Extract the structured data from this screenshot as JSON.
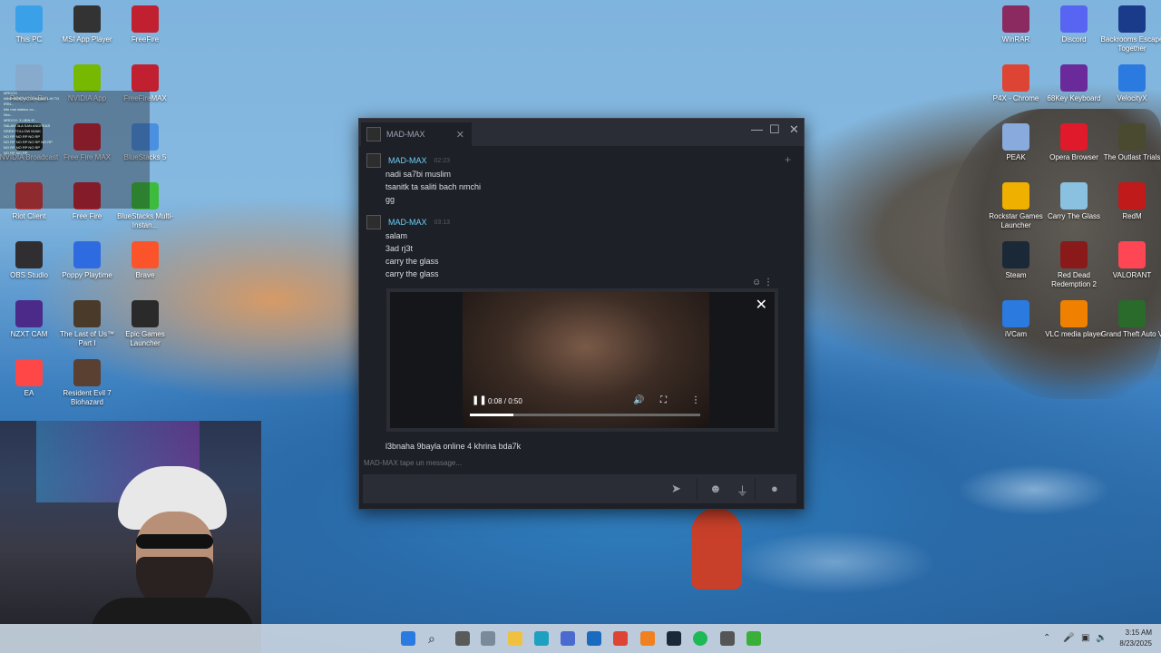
{
  "desktop": {
    "left_icons": [
      {
        "label": "This PC",
        "color": "#3aa0e8"
      },
      {
        "label": "MSI App Player",
        "color": "#333333"
      },
      {
        "label": "FreeFire",
        "color": "#c02030"
      },
      {
        "label": "Recycle Bin",
        "color": "#88aacc"
      },
      {
        "label": "NVIDIA App",
        "color": "#76b900"
      },
      {
        "label": "FreeFireMAX",
        "color": "#c02030"
      },
      {
        "label": "NVIDIA Broadcast",
        "color": "#1a1a1a"
      },
      {
        "label": "Free Fire MAX",
        "color": "#c02030"
      },
      {
        "label": "BlueStacks 5",
        "color": "#4a8fe0"
      },
      {
        "label": "Riot Client",
        "color": "#d13639"
      },
      {
        "label": "Free Fire",
        "color": "#c02030"
      },
      {
        "label": "BlueStacks Multi-Instan...",
        "color": "#3dbb3d"
      },
      {
        "label": "OBS Studio",
        "color": "#302e31"
      },
      {
        "label": "Poppy Playtime",
        "color": "#2f6be0"
      },
      {
        "label": "Brave",
        "color": "#fb542b"
      },
      {
        "label": "NZXT CAM",
        "color": "#4b2a8a"
      },
      {
        "label": "The Last of Us™ Part I",
        "color": "#4a3a2a"
      },
      {
        "label": "Epic Games Launcher",
        "color": "#2a2a2a"
      },
      {
        "label": "EA",
        "color": "#ff4747"
      },
      {
        "label": "Resident Evil 7 Biohazard",
        "color": "#5a4030"
      }
    ],
    "right_icons": [
      {
        "label": "WinRAR",
        "color": "#8a2a60"
      },
      {
        "label": "Discord",
        "color": "#5865f2"
      },
      {
        "label": "Backrooms Escape Together",
        "color": "#1a3a8a"
      },
      {
        "label": "P4X - Chrome",
        "color": "#dd4433"
      },
      {
        "label": "68Key Keyboard",
        "color": "#6a2a9a"
      },
      {
        "label": "VelocityX",
        "color": "#2a7ae0"
      },
      {
        "label": "PEAK",
        "color": "#88aadd"
      },
      {
        "label": "Opera Browser",
        "color": "#e01a2a"
      },
      {
        "label": "The Outlast Trials",
        "color": "#4a4a30"
      },
      {
        "label": "Rockstar Games Launcher",
        "color": "#f0b000"
      },
      {
        "label": "Carry The Glass",
        "color": "#8ac0e0"
      },
      {
        "label": "RedM",
        "color": "#c01a1a"
      },
      {
        "label": "Steam",
        "color": "#1b2838"
      },
      {
        "label": "Red Dead Redemption 2",
        "color": "#8a1a1a"
      },
      {
        "label": "VALORANT",
        "color": "#ff4655"
      },
      {
        "label": "iVCam",
        "color": "#2a7ae0"
      },
      {
        "label": "VLC media player",
        "color": "#f08000"
      },
      {
        "label": "Grand Theft Auto V",
        "color": "#2a6a2a"
      }
    ]
  },
  "chat_window": {
    "tab_title": "MAD-MAX",
    "groups": [
      {
        "user": "MAD-MAX",
        "time": "02:23",
        "lines": [
          "nadi sa7bi muslim",
          "tsanitk ta saliti bach nmchi",
          "gg"
        ]
      },
      {
        "user": "MAD-MAX",
        "time": "03:13",
        "lines": [
          "salam",
          "3ad rj3t",
          "carry the glass",
          "carry the glass"
        ]
      }
    ],
    "video": {
      "time": "0:08 / 0:50",
      "progress": 0.19
    },
    "after_embed": "l3bnaha 9bayla online 4 khrina bda7k",
    "typing_status": "MAD-MAX tape un message...",
    "input_placeholder": ""
  },
  "taskbar": {
    "clock_time": "3:15 AM",
    "clock_date": "8/23/2025"
  }
}
